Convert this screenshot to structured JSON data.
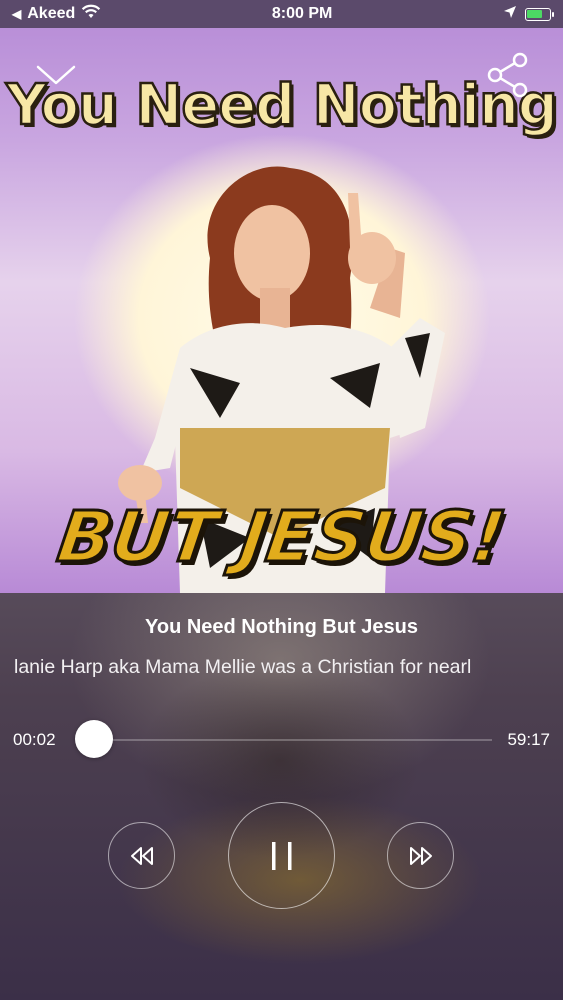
{
  "status_bar": {
    "back_label": "Akeed",
    "time": "8:00 PM",
    "battery_color": "#4cd964"
  },
  "artwork": {
    "title_text": "You Need Nothing",
    "subtitle_text": "BUT JESUS!",
    "background_accent": "#b98fd8"
  },
  "player": {
    "track_title": "You Need Nothing But Jesus",
    "description": "lanie Harp aka Mama Mellie was a Christian for nearl",
    "elapsed": "00:02",
    "total": "59:17",
    "progress_fraction": 0.0006
  },
  "controls": {
    "rewind_icon": "rewind-icon",
    "play_pause_icon": "pause-icon",
    "forward_icon": "fast-forward-icon"
  }
}
